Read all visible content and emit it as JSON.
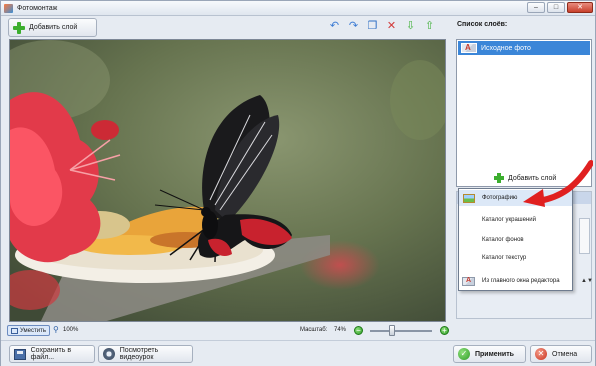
{
  "window": {
    "title": "Фотомонтаж",
    "minimize": "–",
    "maximize": "□",
    "close": "✕"
  },
  "toolbar": {
    "add_layer_label": "Добавить слой",
    "icons": [
      "undo-icon",
      "redo-icon",
      "copy-icon",
      "delete-icon",
      "move-down-icon",
      "move-up-icon"
    ],
    "undo": "↶",
    "redo": "↷",
    "copy": "❐",
    "delete": "✕",
    "down": "⇩",
    "up": "⇧"
  },
  "statusbar": {
    "fit_label": "Уместить",
    "zoom_100": "100%",
    "scale_label": "Масштаб:",
    "scale_value": "74%",
    "zoom_minus": "−",
    "zoom_plus": "+",
    "zoom_level": 0.74
  },
  "layers": {
    "title": "Список слоёв:",
    "items": [
      {
        "label": "Исходное фото",
        "selected": true
      }
    ],
    "add_layer_label": "Добавить слой"
  },
  "add_menu": {
    "items": [
      {
        "label": "Фотографию",
        "icon": "photo-icon",
        "highlighted": true
      },
      {
        "label": "Каталог украшений",
        "icon": ""
      },
      {
        "label": "Каталог фонов",
        "icon": ""
      },
      {
        "label": "Каталог текстур",
        "icon": ""
      },
      {
        "label": "Из главного окна редактора",
        "icon": "editor-icon"
      }
    ]
  },
  "bottom": {
    "save_label": "Сохранить в файл...",
    "video_label": "Посмотреть видеоурок",
    "apply_label": "Применить",
    "cancel_label": "Отмена",
    "apply_check": "✓",
    "cancel_x": "✕"
  },
  "colors": {
    "accent_blue": "#3b86d8",
    "arrow_red": "#e02020",
    "green": "#3cae2e"
  }
}
